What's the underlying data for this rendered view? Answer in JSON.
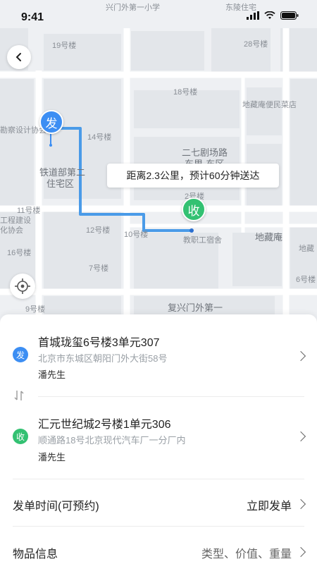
{
  "status_bar": {
    "time": "9:41"
  },
  "map": {
    "labels": {
      "top_school": "兴门外第一小学",
      "top_residence": "东陵住宅",
      "b19": "19号楼",
      "b28": "28号楼",
      "b18": "18号楼",
      "market": "地藏庵便民菜店",
      "design_assoc": "勘察设计协会",
      "b14": "14号楼",
      "theater_road": "二七剧场路",
      "east_area": "东里-东区",
      "railway": "铁道部第二",
      "residential": "住宅区",
      "b11": "11号楼",
      "b12": "12号楼",
      "b10": "10号楼",
      "b2x": "2号楼",
      "staff_dorm": "教职工宿舍",
      "dizang": "地藏庵",
      "dizang_right": "地藏",
      "eng_construction": "工程建设",
      "assoc2": "化协会",
      "b16": "16号楼",
      "b7": "7号楼",
      "b6": "6号楼",
      "b9": "9号楼",
      "fuxing": "复兴门外第一"
    },
    "route_tip": "距离2.3公里，预计60分钟送达",
    "pin_from": "发",
    "pin_to": "收"
  },
  "sender": {
    "badge": "发",
    "title": "首城珑玺6号楼3单元307",
    "address": "北京市东城区朝阳门外大街58号",
    "person": "潘先生"
  },
  "receiver": {
    "badge": "收",
    "title": "汇元世纪城2号楼1单元306",
    "address": "顺通路18号北京现代汽车厂一分厂内",
    "person": "潘先生"
  },
  "send_time": {
    "label": "发单时间(可预约)",
    "value": "立即发单"
  },
  "item_info": {
    "label": "物品信息",
    "value": "类型、价值、重量"
  },
  "colors": {
    "from": "#3c8ef3",
    "to": "#33c172",
    "route": "#4a9be8"
  }
}
